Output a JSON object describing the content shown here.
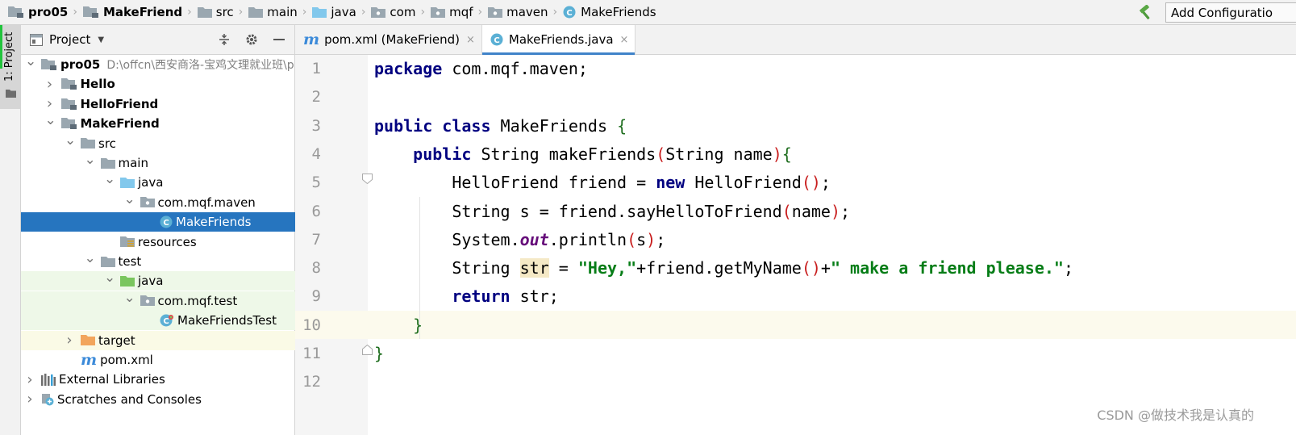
{
  "breadcrumbs": [
    {
      "label": "pro05",
      "icon": "module-folder-icon",
      "bold": true
    },
    {
      "label": "MakeFriend",
      "icon": "module-folder-icon",
      "bold": true
    },
    {
      "label": "src",
      "icon": "folder-icon",
      "bold": false
    },
    {
      "label": "main",
      "icon": "folder-icon",
      "bold": false
    },
    {
      "label": "java",
      "icon": "source-folder-icon",
      "bold": false
    },
    {
      "label": "com",
      "icon": "package-icon",
      "bold": false
    },
    {
      "label": "mqf",
      "icon": "package-icon",
      "bold": false
    },
    {
      "label": "maven",
      "icon": "package-icon",
      "bold": false
    },
    {
      "label": "MakeFriends",
      "icon": "class-icon",
      "bold": false
    }
  ],
  "toolbar": {
    "run_config_label": "Add Configuratio"
  },
  "stripe": {
    "project_tab_label": "1: Project"
  },
  "project_panel": {
    "title": "Project",
    "tree": [
      {
        "label": "pro05",
        "path": "D:\\offcn\\西安商洛-宝鸡文理就业班\\p",
        "depth": 0,
        "arrow": "down",
        "icon": "module-folder-icon",
        "bold": true
      },
      {
        "label": "Hello",
        "depth": 1,
        "arrow": "right",
        "icon": "module-folder-icon",
        "bold": true
      },
      {
        "label": "HelloFriend",
        "depth": 1,
        "arrow": "right",
        "icon": "module-folder-icon",
        "bold": true
      },
      {
        "label": "MakeFriend",
        "depth": 1,
        "arrow": "down",
        "icon": "module-folder-icon",
        "bold": true
      },
      {
        "label": "src",
        "depth": 2,
        "arrow": "down",
        "icon": "folder-icon"
      },
      {
        "label": "main",
        "depth": 3,
        "arrow": "down",
        "icon": "folder-icon"
      },
      {
        "label": "java",
        "depth": 4,
        "arrow": "down",
        "icon": "source-folder-icon"
      },
      {
        "label": "com.mqf.maven",
        "depth": 5,
        "arrow": "down",
        "icon": "package-icon"
      },
      {
        "label": "MakeFriends",
        "depth": 6,
        "arrow": "none",
        "icon": "class-icon",
        "selected": true
      },
      {
        "label": "resources",
        "depth": 4,
        "arrow": "none",
        "icon": "resources-folder-icon"
      },
      {
        "label": "test",
        "depth": 3,
        "arrow": "down",
        "icon": "folder-icon"
      },
      {
        "label": "java",
        "depth": 4,
        "arrow": "down",
        "icon": "test-source-folder-icon",
        "bg": "test"
      },
      {
        "label": "com.mqf.test",
        "depth": 5,
        "arrow": "down",
        "icon": "package-icon",
        "bg": "test"
      },
      {
        "label": "MakeFriendsTest",
        "depth": 6,
        "arrow": "none",
        "icon": "test-class-icon",
        "bg": "test"
      },
      {
        "label": "target",
        "depth": 2,
        "arrow": "right",
        "icon": "excluded-folder-icon",
        "bg": "target"
      },
      {
        "label": "pom.xml",
        "depth": 2,
        "arrow": "none",
        "icon": "maven-icon"
      },
      {
        "label": "External Libraries",
        "depth": 0,
        "arrow": "right",
        "icon": "libraries-icon"
      },
      {
        "label": "Scratches and Consoles",
        "depth": 0,
        "arrow": "right",
        "icon": "scratches-icon"
      }
    ]
  },
  "editor": {
    "tabs": [
      {
        "label": "pom.xml (MakeFriend)",
        "icon": "maven-icon",
        "active": false
      },
      {
        "label": "MakeFriends.java",
        "icon": "class-icon",
        "active": true
      }
    ],
    "close_glyph": "×",
    "line_numbers": [
      "1",
      "2",
      "3",
      "4",
      "5",
      "6",
      "7",
      "8",
      "9",
      "10",
      "11",
      "12"
    ],
    "code": [
      [
        {
          "t": "package",
          "c": "kw"
        },
        {
          "t": " com.mqf.maven;"
        }
      ],
      [],
      [
        {
          "t": "public",
          "c": "kw"
        },
        {
          "t": " "
        },
        {
          "t": "class",
          "c": "kw"
        },
        {
          "t": " MakeFriends "
        },
        {
          "t": "{",
          "c": "pb"
        }
      ],
      [
        {
          "t": "    "
        },
        {
          "t": "public",
          "c": "kw"
        },
        {
          "t": " String makeFriends"
        },
        {
          "t": "(",
          "c": "pa"
        },
        {
          "t": "String name"
        },
        {
          "t": ")",
          "c": "pa"
        },
        {
          "t": "{",
          "c": "pb"
        }
      ],
      [
        {
          "t": "        HelloFriend friend = "
        },
        {
          "t": "new",
          "c": "kw"
        },
        {
          "t": " HelloFriend"
        },
        {
          "t": "()",
          "c": "pa"
        },
        {
          "t": ";"
        }
      ],
      [
        {
          "t": "        String s = friend.sayHelloToFriend"
        },
        {
          "t": "(",
          "c": "pa"
        },
        {
          "t": "name"
        },
        {
          "t": ")",
          "c": "pa"
        },
        {
          "t": ";"
        }
      ],
      [
        {
          "t": "        System."
        },
        {
          "t": "out",
          "c": "fld"
        },
        {
          "t": ".println"
        },
        {
          "t": "(",
          "c": "pa"
        },
        {
          "t": "s"
        },
        {
          "t": ")",
          "c": "pa"
        },
        {
          "t": ";"
        }
      ],
      [
        {
          "t": "        String "
        },
        {
          "t": "str",
          "c": "hl"
        },
        {
          "t": " = "
        },
        {
          "t": "\"Hey,\"",
          "c": "str"
        },
        {
          "t": "+friend.getMyName"
        },
        {
          "t": "()",
          "c": "pa"
        },
        {
          "t": "+"
        },
        {
          "t": "\" make a friend please.\"",
          "c": "str"
        },
        {
          "t": ";"
        }
      ],
      [
        {
          "t": "        "
        },
        {
          "t": "return",
          "c": "kw"
        },
        {
          "t": " str;"
        }
      ],
      [
        {
          "t": "    "
        },
        {
          "t": "}",
          "c": "pb"
        }
      ],
      [
        {
          "t": "}",
          "c": "pb"
        }
      ],
      []
    ],
    "caret_line": 9
  },
  "watermark": "CSDN @做技术我是认真的",
  "colors": {
    "selection": "#2675bf",
    "keyword": "#000080",
    "string": "#067d17",
    "field": "#660e7a",
    "test_bg": "#eef8e8",
    "caret_line": "#fcfaed"
  }
}
